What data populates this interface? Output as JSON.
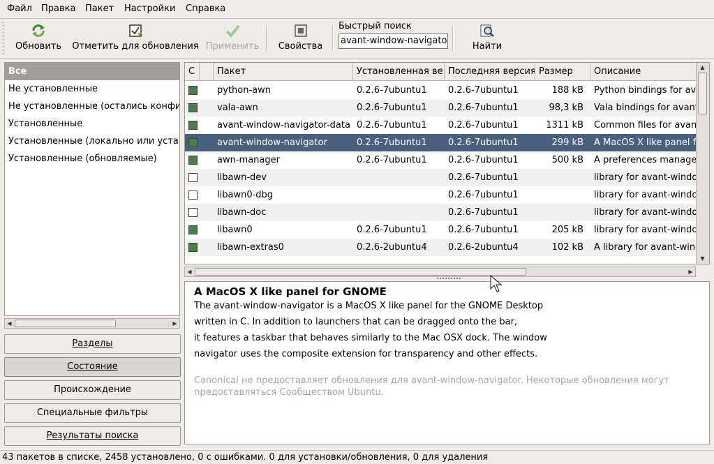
{
  "menubar": {
    "items": [
      "Файл",
      "Правка",
      "Пакет",
      "Настройки",
      "Справка"
    ]
  },
  "toolbar": {
    "reload": {
      "label": "Обновить",
      "icon": "refresh-icon"
    },
    "mark_upgrades": {
      "label": "Отметить для обновления",
      "icon": "mark-upgrades-icon"
    },
    "apply": {
      "label": "Применить",
      "icon": "apply-checkmark-icon",
      "disabled": true
    },
    "properties": {
      "label": "Свойства",
      "icon": "properties-icon"
    },
    "quick_search": {
      "label": "Быстрый поиск",
      "value": "avant-window-navigator"
    },
    "find": {
      "label": "Найти",
      "icon": "find-icon"
    }
  },
  "categories": {
    "items": [
      {
        "label": "Все",
        "selected": true
      },
      {
        "label": "Не установленные"
      },
      {
        "label": "Не установленные (остались конфи"
      },
      {
        "label": "Установленные"
      },
      {
        "label": "Установленные (локально или устар"
      },
      {
        "label": "Установленные (обновляемые)"
      }
    ]
  },
  "filters": {
    "sections": "Разделы",
    "status": "Состояние",
    "origin": "Происхождение",
    "custom": "Специальные фильтры",
    "search_results": "Результаты поиска"
  },
  "table": {
    "columns": [
      "С",
      "",
      "Пакет",
      "Установленная ве",
      "Последняя версия",
      "Размер",
      "Описание"
    ],
    "rows": [
      {
        "installed": true,
        "name": "python-awn",
        "inst_ver": "0.2.6-7ubuntu1",
        "latest_ver": "0.2.6-7ubuntu1",
        "size": "188 kB",
        "desc": "Python bindings for avant-window-navigator"
      },
      {
        "installed": true,
        "name": "vala-awn",
        "inst_ver": "0.2.6-7ubuntu1",
        "latest_ver": "0.2.6-7ubuntu1",
        "size": "98,3 kB",
        "desc": "Vala bindings for avant-window-navigator"
      },
      {
        "installed": true,
        "name": "avant-window-navigator-data",
        "inst_ver": "0.2.6-7ubuntu1",
        "latest_ver": "0.2.6-7ubuntu1",
        "size": "1311 kB",
        "desc": "Common files for avant-window-navigator"
      },
      {
        "installed": true,
        "selected": true,
        "name": "avant-window-navigator",
        "inst_ver": "0.2.6-7ubuntu1",
        "latest_ver": "0.2.6-7ubuntu1",
        "size": "299 kB",
        "desc": "A MacOS X like panel for GNOME"
      },
      {
        "installed": true,
        "name": "awn-manager",
        "inst_ver": "0.2.6-7ubuntu1",
        "latest_ver": "0.2.6-7ubuntu1",
        "size": "500 kB",
        "desc": "A preferences manager for avant-window-navigator"
      },
      {
        "installed": false,
        "name": "libawn-dev",
        "inst_ver": "",
        "latest_ver": "0.2.6-7ubuntu1",
        "size": "",
        "desc": "library for avant-window-navigator"
      },
      {
        "installed": false,
        "name": "libawn0-dbg",
        "inst_ver": "",
        "latest_ver": "0.2.6-7ubuntu1",
        "size": "",
        "desc": "library for avant-window-navigator"
      },
      {
        "installed": false,
        "name": "libawn-doc",
        "inst_ver": "",
        "latest_ver": "0.2.6-7ubuntu1",
        "size": "",
        "desc": "library for avant-window-navigator"
      },
      {
        "installed": true,
        "name": "libawn0",
        "inst_ver": "0.2.6-7ubuntu1",
        "latest_ver": "0.2.6-7ubuntu1",
        "size": "205 kB",
        "desc": "library for avant-window-navigator"
      },
      {
        "installed": true,
        "name": "libawn-extras0",
        "inst_ver": "0.2.6-2ubuntu4",
        "latest_ver": "0.2.6-2ubuntu4",
        "size": "102 kB",
        "desc": "A library for avant-window-navigator"
      }
    ]
  },
  "description": {
    "title": "A MacOS X like panel for GNOME",
    "lines": [
      "The avant-window-navigator is a MacOS X like panel for the GNOME Desktop",
      "written in C.  In addition to launchers that can be dragged onto the bar,",
      "it features a taskbar that behaves similarly to the Mac OSX dock. The window",
      "navigator uses the composite extension for transparency and other effects."
    ],
    "note": "Canonical не предоставляет обновления для avant-window-navigator. Некоторые обновления могут предоставляться Сообществом Ubuntu."
  },
  "statusbar": {
    "text": "43 пакетов в списке, 2458 установлено, 0 с ошибками. 0 для установки/обновления, 0 для удаления"
  },
  "colors": {
    "selection": "#4a6080",
    "installed_check": "#4e7a4e",
    "background": "#efebe7"
  }
}
